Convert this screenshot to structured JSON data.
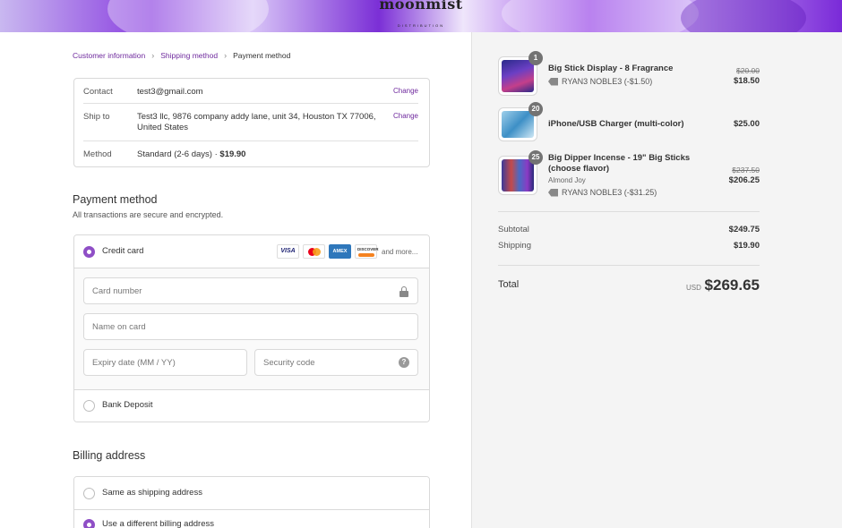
{
  "brand": {
    "logo_text": "moonmist",
    "logo_sub": "DISTRIBUTION"
  },
  "breadcrumb": {
    "items": [
      "Customer information",
      "Shipping method",
      "Payment method"
    ],
    "separator": "›"
  },
  "review": {
    "contact_label": "Contact",
    "contact_value": "test3@gmail.com",
    "ship_label": "Ship to",
    "ship_value": "Test3 llc, 9876 company addy lane, unit 34, Houston TX 77006, United States",
    "method_label": "Method",
    "method_value": "Standard (2-6 days) · ",
    "method_price": "$19.90",
    "change_label": "Change"
  },
  "payment": {
    "title": "Payment method",
    "subtitle": "All transactions are secure and encrypted.",
    "credit_card_label": "Credit card",
    "card_icons": [
      "VISA",
      "mastercard-icon",
      "AMEX",
      "discover-icon"
    ],
    "visa_text": "VISA",
    "amex_text": "AMEX",
    "discover_text": "DISCOVER",
    "more_text": "and more...",
    "card_number_placeholder": "Card number",
    "name_placeholder": "Name on card",
    "expiry_placeholder": "Expiry date (MM / YY)",
    "security_placeholder": "Security code",
    "help_glyph": "?",
    "bank_label": "Bank Deposit",
    "selected": "Credit card"
  },
  "billing": {
    "title": "Billing address",
    "same_label": "Same as shipping address",
    "different_label": "Use a different billing address",
    "selected": "Use a different billing address"
  },
  "order": {
    "items": [
      {
        "qty": "1",
        "name": "Big Stick Display - 8 Fragrance",
        "variant": "",
        "discount": "RYAN3 NOBLE3 (-$1.50)",
        "old_price": "$20.00",
        "price": "$18.50"
      },
      {
        "qty": "20",
        "name": "iPhone/USB Charger (multi-color)",
        "variant": "",
        "discount": "",
        "old_price": "",
        "price": "$25.00"
      },
      {
        "qty": "25",
        "name": "Big Dipper Incense - 19\" Big Sticks (choose flavor)",
        "variant": "Almond Joy",
        "discount": "RYAN3 NOBLE3 (-$31.25)",
        "old_price": "$237.50",
        "price": "$206.25"
      }
    ],
    "subtotal_label": "Subtotal",
    "subtotal_value": "$249.75",
    "shipping_label": "Shipping",
    "shipping_value": "$19.90",
    "total_label": "Total",
    "currency": "USD",
    "total_value": "$269.65"
  },
  "colors": {
    "accent": "#6f2a9e",
    "radio": "#8f4fc6",
    "sidebar_bg": "#f4f4f4"
  }
}
